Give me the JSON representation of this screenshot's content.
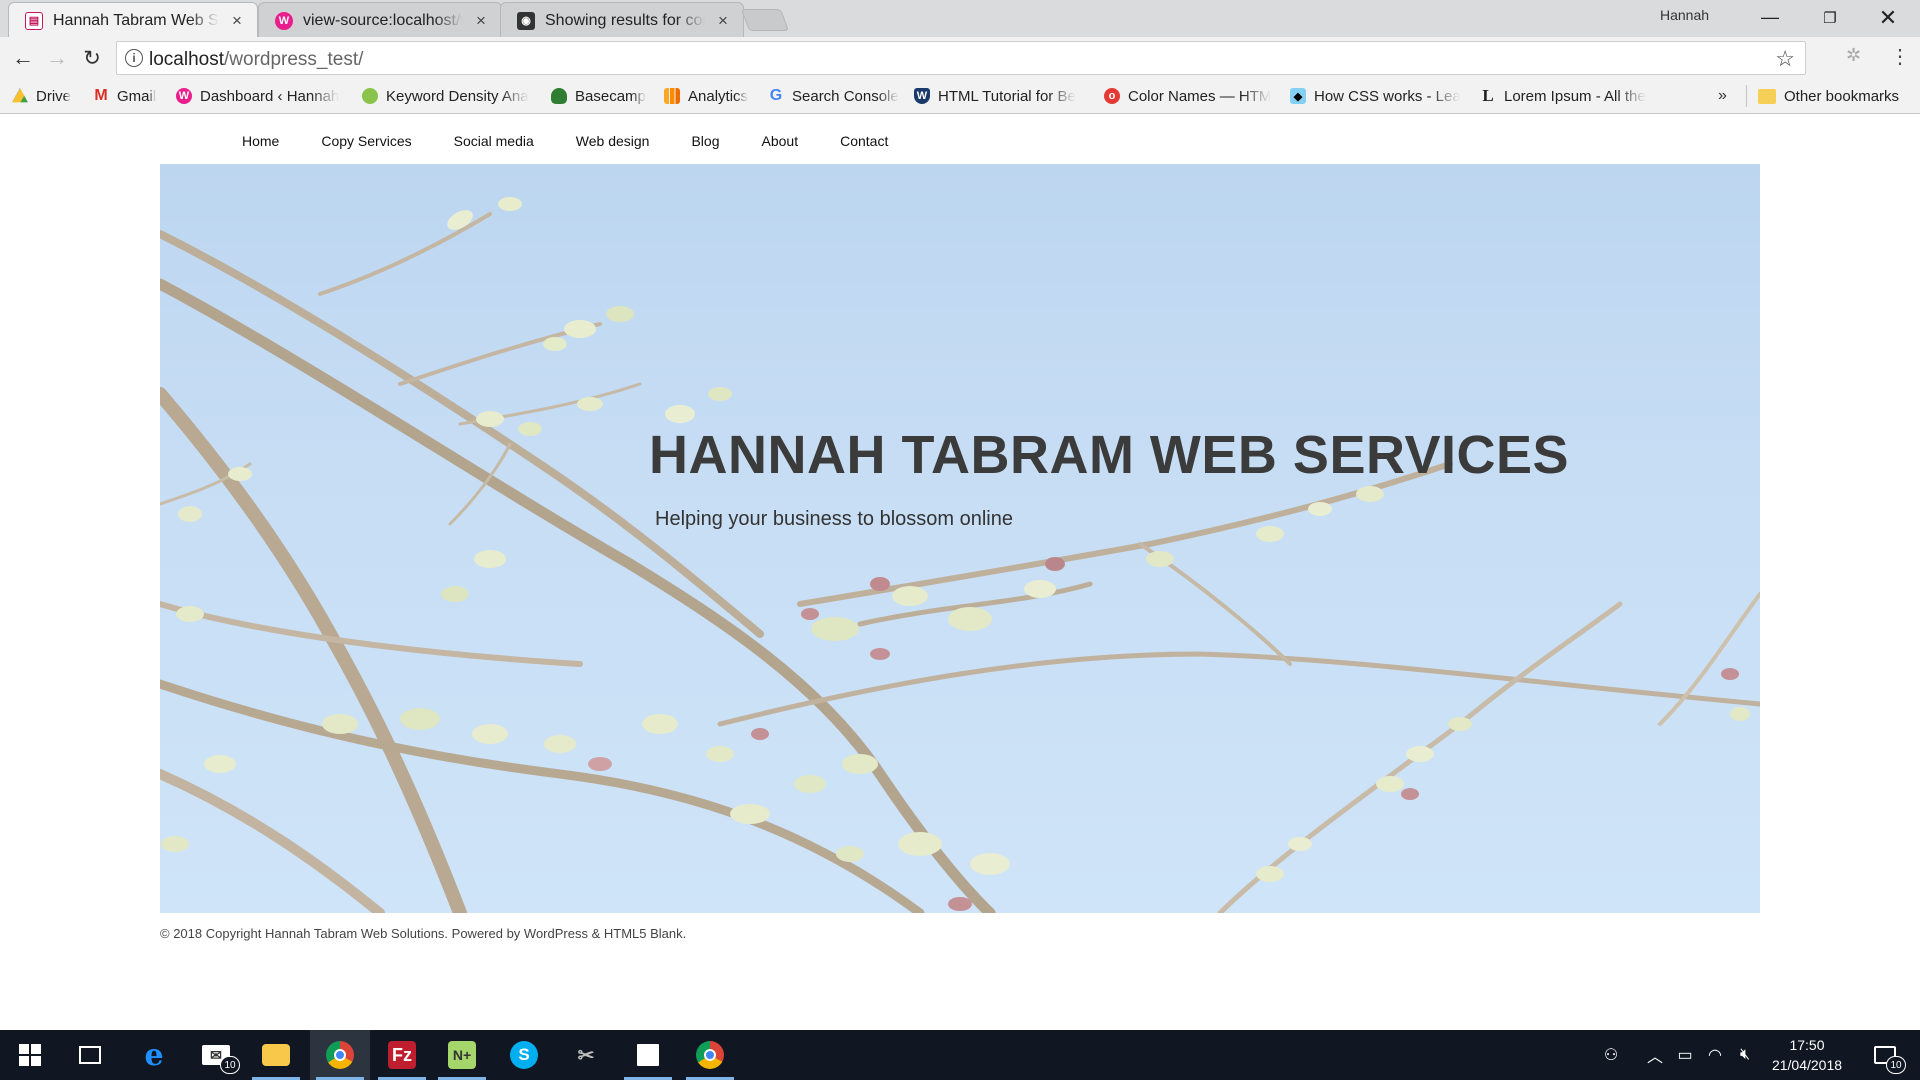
{
  "browser": {
    "tabs": [
      {
        "title": "Hannah Tabram Web Sol",
        "favicon": "wordpress-page-icon",
        "active": true
      },
      {
        "title": "view-source:localhost/wo",
        "favicon": "source-icon",
        "active": false
      },
      {
        "title": "Showing results for conte",
        "favicon": "search-results-icon",
        "active": false
      }
    ],
    "profile_name": "Hannah",
    "url_host": "localhost",
    "url_path": "/wordpress_test/",
    "bookmarks": [
      {
        "label": "Drive",
        "icon": "drive-icon"
      },
      {
        "label": "Gmail",
        "icon": "gmail-icon"
      },
      {
        "label": "Dashboard ‹ Hannah",
        "icon": "wordpress-dashboard-icon"
      },
      {
        "label": "Keyword Density Ana",
        "icon": "keyword-icon"
      },
      {
        "label": "Basecamp",
        "icon": "basecamp-icon"
      },
      {
        "label": "Analytics",
        "icon": "analytics-icon"
      },
      {
        "label": "Search Console",
        "icon": "google-icon"
      },
      {
        "label": "HTML Tutorial for Be",
        "icon": "shield-icon"
      },
      {
        "label": "Color Names — HTM",
        "icon": "opera-icon"
      },
      {
        "label": "How CSS works - Lea",
        "icon": "mdn-icon"
      },
      {
        "label": "Lorem Ipsum - All the",
        "icon": "lorem-icon"
      }
    ],
    "bookmarks_more": "»",
    "other_bookmarks": "Other bookmarks"
  },
  "site": {
    "nav": [
      "Home",
      "Copy Services",
      "Social media",
      "Web design",
      "Blog",
      "About",
      "Contact"
    ],
    "hero_title": "HANNAH TABRAM WEB SERVICES",
    "hero_subtitle": "Helping your business to blossom online",
    "footer": "© 2018 Copyright Hannah Tabram Web Solutions. Powered by WordPress & HTML5 Blank."
  },
  "taskbar": {
    "mail_badge": "10",
    "notifications_badge": "10",
    "time": "17:50",
    "date": "21/04/2018",
    "apps": [
      "start-icon",
      "task-view-icon",
      "edge-icon",
      "mail-icon",
      "file-explorer-icon",
      "chrome-icon",
      "filezilla-icon",
      "notepad-plus-icon",
      "skype-icon",
      "snipping-icon",
      "sticky-notes-icon",
      "chrome-icon"
    ]
  },
  "colors": {
    "hero_sky": "#c6ddf4",
    "hero_title": "#3b3b3b",
    "taskbar": "#101722",
    "chrome_frame": "#dadbdc"
  }
}
